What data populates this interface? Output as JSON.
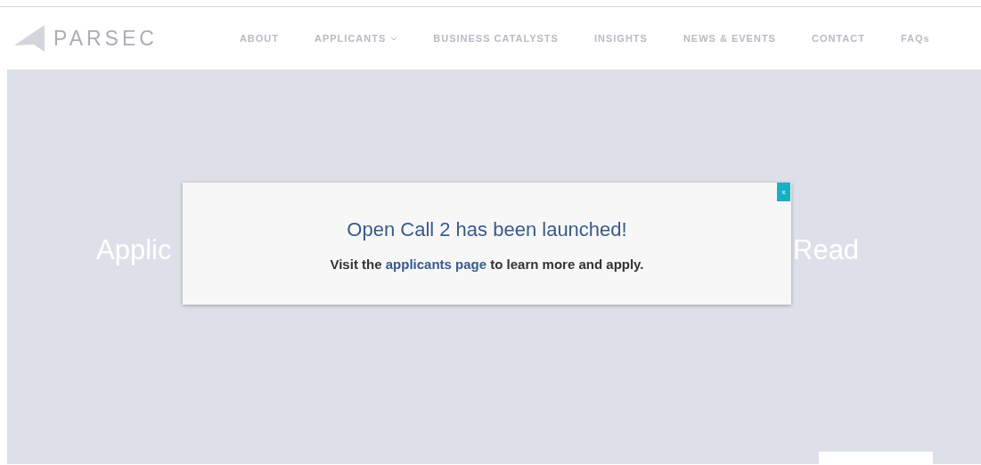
{
  "header": {
    "logo": "PARSEC",
    "nav": [
      {
        "label": "ABOUT",
        "dropdown": false
      },
      {
        "label": "APPLICANTS",
        "dropdown": true
      },
      {
        "label": "BUSINESS CATALYSTS",
        "dropdown": false
      },
      {
        "label": "INSIGHTS",
        "dropdown": false
      },
      {
        "label": "NEWS & EVENTS",
        "dropdown": false
      },
      {
        "label": "CONTACT",
        "dropdown": false
      },
      {
        "label": "FAQs",
        "dropdown": false
      }
    ]
  },
  "hero": {
    "text_left": "Applic",
    "text_right": "Read"
  },
  "modal": {
    "close": "x",
    "title": "Open Call 2 has been launched!",
    "message_before": "Visit the",
    "link": "applicants page",
    "message_after": "to learn more and apply."
  }
}
